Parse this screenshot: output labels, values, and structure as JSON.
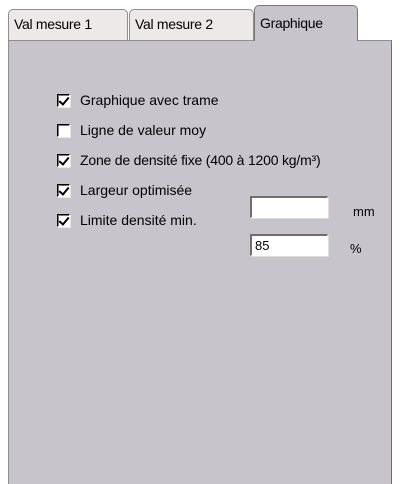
{
  "tabs": [
    {
      "label": "Val mesure 1"
    },
    {
      "label": "Val mesure 2"
    },
    {
      "label": "Graphique",
      "active": true
    }
  ],
  "options": [
    {
      "label": "Graphique avec trame",
      "checked": true
    },
    {
      "label": "Ligne de valeur moy",
      "checked": false
    },
    {
      "label": "Zone de densité fixe (400 à 1200 kg/m³)",
      "checked": true
    },
    {
      "label": "Largeur optimisée",
      "checked": true
    },
    {
      "label": "Limite densité min.",
      "checked": true
    }
  ],
  "largeur_field": {
    "value": "",
    "unit": "mm"
  },
  "densite_field": {
    "value": "85",
    "unit": "%"
  }
}
